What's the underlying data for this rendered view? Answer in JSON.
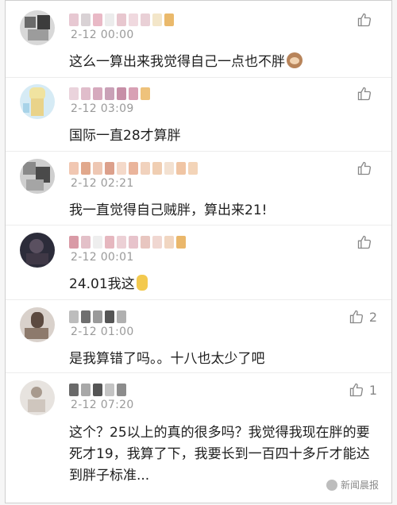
{
  "comments": [
    {
      "time": "2-12 00:00",
      "text": "这么一算出来我觉得自己一点也不胖",
      "likes": ""
    },
    {
      "time": "2-12 03:09",
      "text": "国际一直28才算胖",
      "likes": ""
    },
    {
      "time": "2-12 02:21",
      "text": "我一直觉得自己贼胖，算出来21!",
      "likes": ""
    },
    {
      "time": "2-12 00:01",
      "text": "24.01我这",
      "likes": ""
    },
    {
      "time": "2-12 01:00",
      "text": "是我算错了吗。。十八也太少了吧",
      "likes": "2"
    },
    {
      "time": "2-12 07:20",
      "text": "这个？25以上的真的很多吗？我觉得我现在胖的要死才19，我算了下，我要长到一百四十多斤才能达到胖子标准...",
      "likes": "1"
    }
  ],
  "icons": {
    "like": "thumbs-up-icon"
  },
  "watermark": {
    "label": "新闻晨报"
  },
  "colors": {
    "text": "#1e1e1e",
    "time": "#9a9a9a",
    "icon": "#888888"
  }
}
